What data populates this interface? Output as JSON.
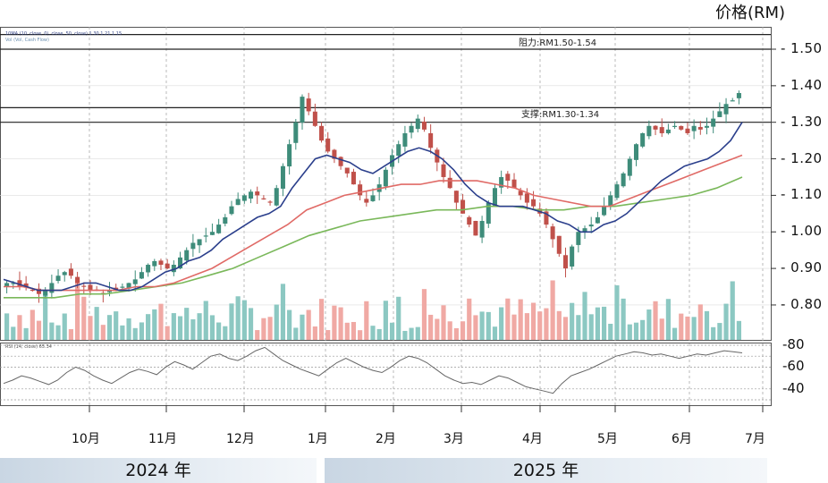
{
  "header": {
    "unit_label": "价格(RM)"
  },
  "legend_text": {
    "main": "10MA (10, close, 0), close, 50, close) 1.30 1.21 1.15",
    "vol": "Vol (Vol, Cash Flow)",
    "rsi": "RSI (14, close) 65.34"
  },
  "annotations": {
    "resistance": "阻力:RM1.50-1.54",
    "support": "支撑:RM1.30-1.34"
  },
  "years": {
    "y2024": "2024 年",
    "y2025": "2025 年"
  },
  "colors": {
    "up": "#3e8c7a",
    "down": "#c0504a",
    "ma_short": "#2b3f8c",
    "ma_mid": "#e06a66",
    "ma_long": "#7ab85a"
  },
  "chart_data": {
    "type": "candlestick",
    "y_ticks": [
      "1.50",
      "1.40",
      "1.30",
      "1.20",
      "1.10",
      "1.00",
      "0.90",
      "0.80"
    ],
    "ylim": [
      0.72,
      1.57
    ],
    "x_ticks": [
      "10月",
      "11月",
      "12月",
      "1月",
      "2月",
      "3月",
      "4月",
      "5月",
      "6月",
      "7月"
    ],
    "rsi_ticks": [
      "80",
      "60",
      "40"
    ],
    "resistance_zone": [
      1.5,
      1.54
    ],
    "support_zone": [
      1.3,
      1.34
    ],
    "close_series": [
      0.86,
      0.86,
      0.85,
      0.85,
      0.84,
      0.83,
      0.84,
      0.86,
      0.88,
      0.89,
      0.88,
      0.86,
      0.85,
      0.84,
      0.84,
      0.83,
      0.84,
      0.84,
      0.85,
      0.86,
      0.87,
      0.89,
      0.91,
      0.92,
      0.91,
      0.9,
      0.91,
      0.93,
      0.95,
      0.97,
      0.98,
      0.99,
      1.0,
      1.02,
      1.04,
      1.07,
      1.09,
      1.1,
      1.11,
      1.1,
      1.09,
      1.08,
      1.12,
      1.18,
      1.24,
      1.3,
      1.37,
      1.33,
      1.29,
      1.25,
      1.22,
      1.2,
      1.18,
      1.16,
      1.13,
      1.1,
      1.08,
      1.1,
      1.13,
      1.17,
      1.21,
      1.24,
      1.27,
      1.29,
      1.31,
      1.28,
      1.23,
      1.19,
      1.15,
      1.12,
      1.08,
      1.05,
      1.02,
      0.99,
      1.03,
      1.08,
      1.12,
      1.15,
      1.14,
      1.12,
      1.1,
      1.08,
      1.07,
      1.05,
      1.02,
      0.98,
      0.94,
      0.9,
      0.96,
      1.0,
      1.01,
      1.02,
      1.04,
      1.07,
      1.1,
      1.13,
      1.16,
      1.2,
      1.24,
      1.27,
      1.29,
      1.28,
      1.27,
      1.28,
      1.29,
      1.28,
      1.27,
      1.29,
      1.28,
      1.29,
      1.31,
      1.33,
      1.35,
      1.36,
      1.38
    ],
    "ma_short": [
      0.87,
      0.86,
      0.85,
      0.84,
      0.84,
      0.84,
      0.85,
      0.86,
      0.86,
      0.85,
      0.84,
      0.84,
      0.85,
      0.87,
      0.89,
      0.9,
      0.92,
      0.93,
      0.95,
      0.98,
      1.0,
      1.02,
      1.04,
      1.05,
      1.07,
      1.12,
      1.16,
      1.2,
      1.21,
      1.2,
      1.19,
      1.17,
      1.16,
      1.18,
      1.2,
      1.22,
      1.23,
      1.22,
      1.2,
      1.17,
      1.13,
      1.1,
      1.08,
      1.07,
      1.07,
      1.07,
      1.06,
      1.05,
      1.03,
      1.02,
      1.0,
      1.0,
      1.02,
      1.03,
      1.05,
      1.08,
      1.11,
      1.14,
      1.16,
      1.18,
      1.19,
      1.2,
      1.22,
      1.25,
      1.3
    ],
    "ma_mid": [
      0.85,
      0.85,
      0.84,
      0.84,
      0.84,
      0.84,
      0.84,
      0.85,
      0.85,
      0.86,
      0.88,
      0.9,
      0.93,
      0.96,
      0.99,
      1.02,
      1.06,
      1.08,
      1.1,
      1.11,
      1.12,
      1.13,
      1.13,
      1.14,
      1.14,
      1.14,
      1.13,
      1.12,
      1.1,
      1.09,
      1.08,
      1.07,
      1.07,
      1.09,
      1.11,
      1.13,
      1.15,
      1.17,
      1.19,
      1.21
    ],
    "ma_long": [
      0.82,
      0.82,
      0.82,
      0.83,
      0.83,
      0.84,
      0.85,
      0.86,
      0.88,
      0.9,
      0.93,
      0.96,
      0.99,
      1.01,
      1.03,
      1.04,
      1.05,
      1.06,
      1.06,
      1.07,
      1.07,
      1.06,
      1.06,
      1.07,
      1.07,
      1.08,
      1.09,
      1.1,
      1.12,
      1.15
    ],
    "rsi": [
      45,
      48,
      52,
      50,
      47,
      44,
      48,
      55,
      60,
      57,
      52,
      48,
      45,
      50,
      55,
      58,
      56,
      53,
      60,
      65,
      62,
      58,
      64,
      70,
      72,
      68,
      66,
      70,
      75,
      78,
      72,
      66,
      62,
      58,
      55,
      52,
      58,
      64,
      68,
      64,
      60,
      57,
      55,
      60,
      66,
      70,
      68,
      64,
      58,
      52,
      48,
      45,
      46,
      44,
      48,
      52,
      50,
      46,
      42,
      40,
      38,
      36,
      45,
      52,
      55,
      58,
      62,
      66,
      70,
      72,
      74,
      73,
      71,
      72,
      70,
      68,
      70,
      72,
      71,
      73,
      75,
      74,
      73
    ]
  }
}
